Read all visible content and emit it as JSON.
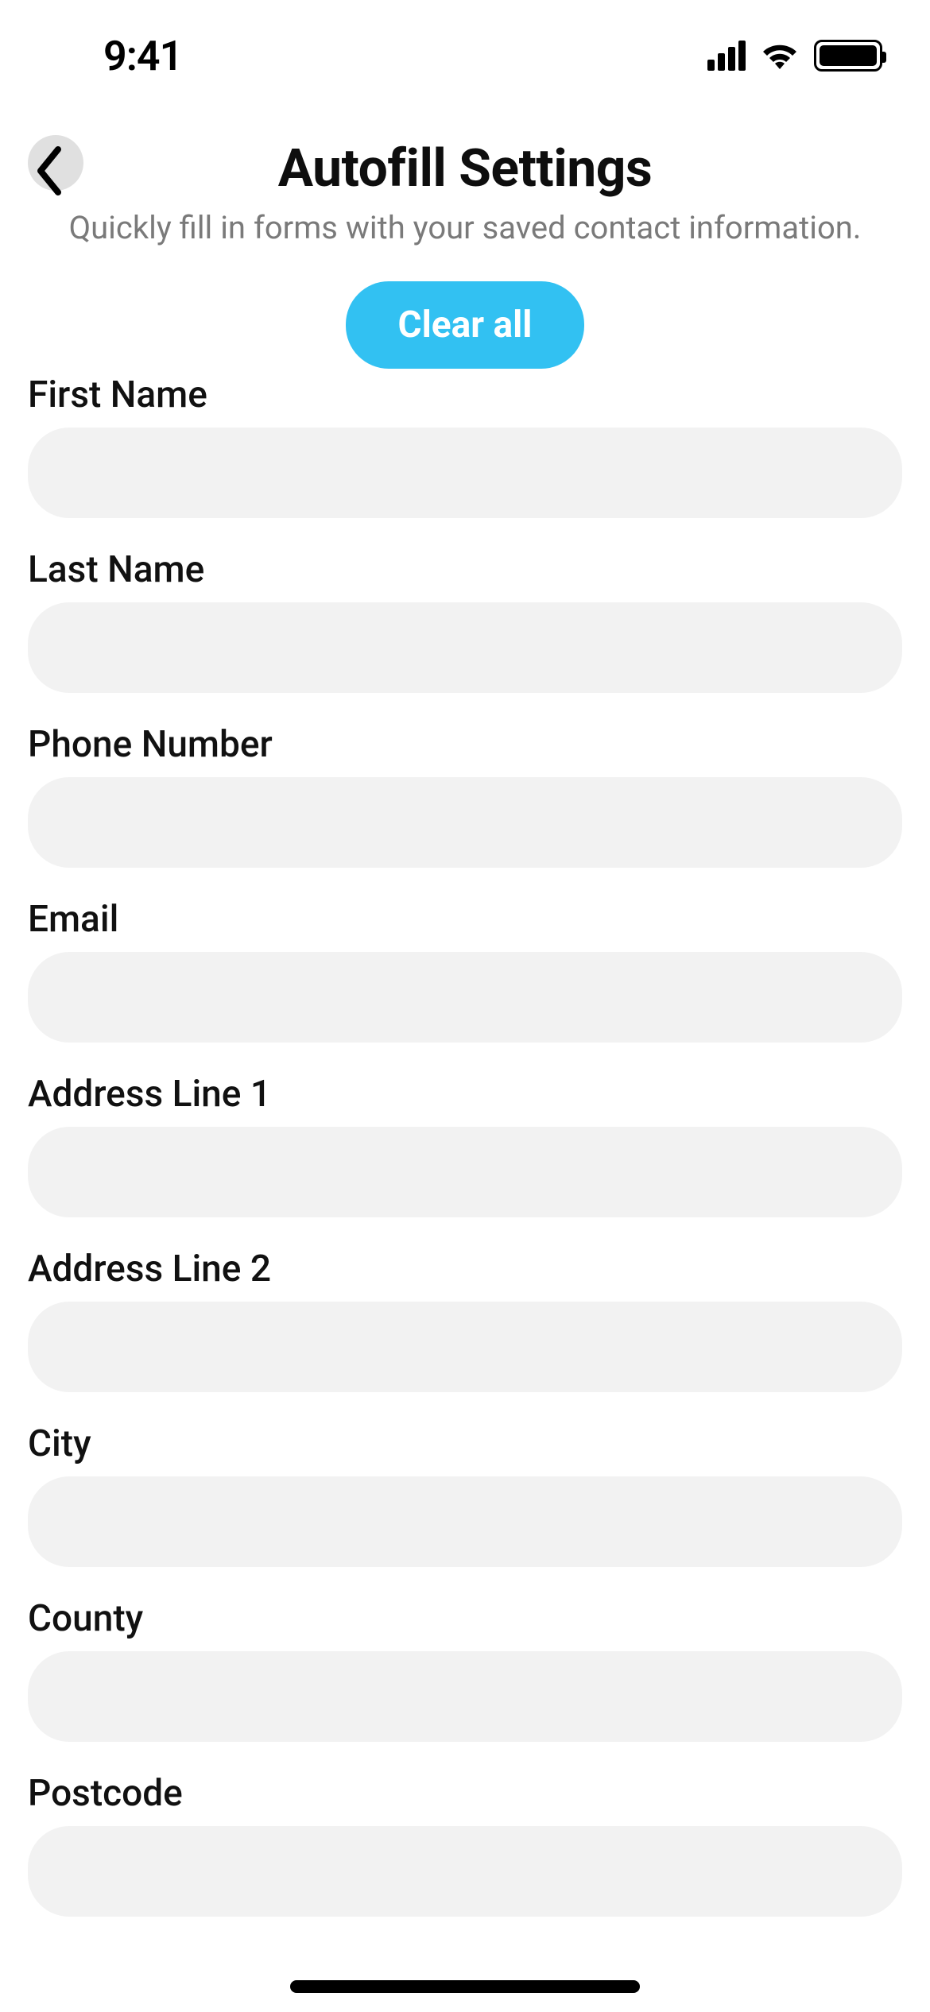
{
  "status": {
    "time": "9:41"
  },
  "header": {
    "title": "Autofill Settings",
    "subtitle": "Quickly fill in forms with your saved contact information.",
    "clear_label": "Clear all"
  },
  "form": {
    "fields": [
      {
        "label": "First Name",
        "value": ""
      },
      {
        "label": "Last Name",
        "value": ""
      },
      {
        "label": "Phone Number",
        "value": ""
      },
      {
        "label": "Email",
        "value": ""
      },
      {
        "label": "Address Line 1",
        "value": ""
      },
      {
        "label": "Address Line 2",
        "value": ""
      },
      {
        "label": "City",
        "value": ""
      },
      {
        "label": "County",
        "value": ""
      },
      {
        "label": "Postcode",
        "value": ""
      }
    ]
  },
  "colors": {
    "accent": "#32c1f2",
    "input_bg": "#f2f2f2",
    "subtitle": "#7a7a7a"
  }
}
